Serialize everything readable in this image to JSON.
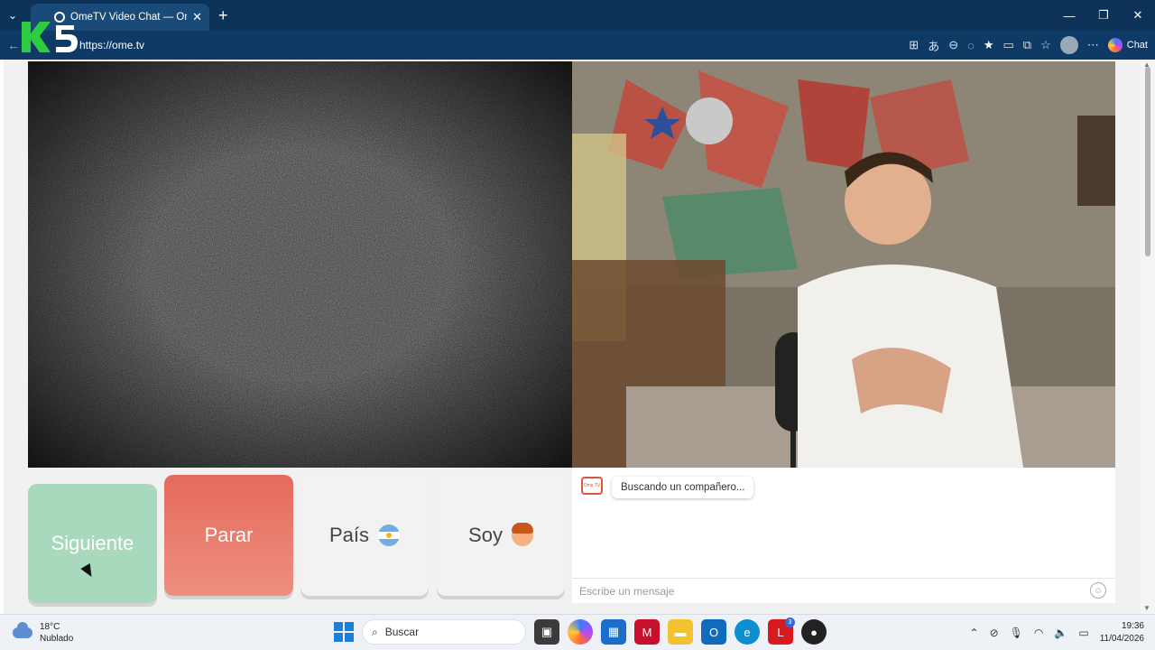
{
  "browser": {
    "tab_title": "OmeTV Video Chat — Omegl",
    "new_tab": "+",
    "url": "https://ome.tv",
    "copilot_label": "Chat",
    "window_controls": [
      "—",
      "❐",
      "✕"
    ]
  },
  "watermark": {
    "logo_text": "K5"
  },
  "controls": {
    "next_label": "Siguiente",
    "stop_label": "Parar",
    "country_label": "País",
    "country_icon": "argentina-flag-icon",
    "gender_label": "Soy",
    "gender_icon": "boy-icon"
  },
  "chat": {
    "logo_text": "Ome TV",
    "status_message": "Buscando un compañero...",
    "input_placeholder": "Escribe un mensaje",
    "emoji_icon": "smiley-icon"
  },
  "taskbar": {
    "weather_temp": "18°C",
    "weather_desc": "Nublado",
    "search_placeholder": "Buscar",
    "mail_badge": "3",
    "time": "19:36",
    "date": "11/04/2026"
  },
  "colors": {
    "next_button": "#a9d9bc",
    "stop_button": "#e46a5c",
    "browser_chrome": "#0d3359"
  }
}
